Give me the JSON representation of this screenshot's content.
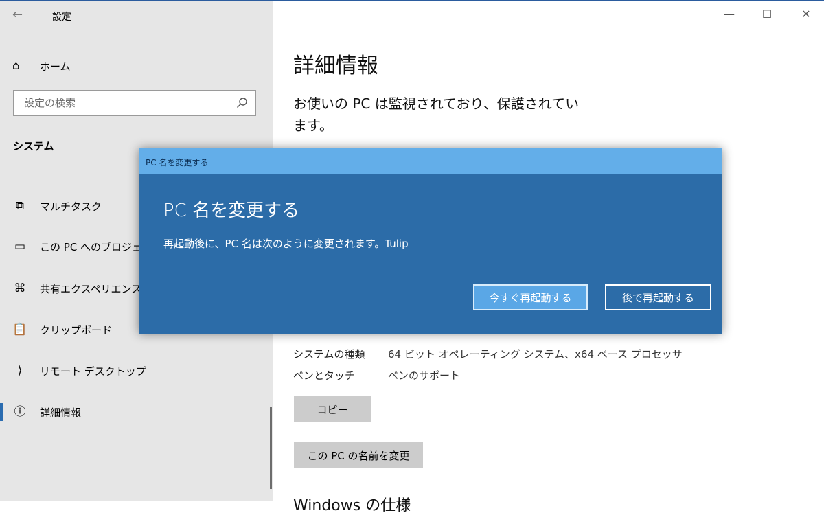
{
  "window": {
    "title": "設定",
    "controls": {
      "minimize": "—",
      "maximize": "☐",
      "close": "✕"
    }
  },
  "sidebar": {
    "home_label": "ホーム",
    "search_placeholder": "設定の検索",
    "section_title": "システム",
    "items": [
      {
        "label": "マルチタスク",
        "icon": "multitask-icon"
      },
      {
        "label": "この PC へのプロジェクション",
        "icon": "projection-icon"
      },
      {
        "label": "共有エクスペリエンス",
        "icon": "shared-experiences-icon"
      },
      {
        "label": "クリップボード",
        "icon": "clipboard-icon"
      },
      {
        "label": "リモート デスクトップ",
        "icon": "remote-desktop-icon"
      },
      {
        "label": "詳細情報",
        "icon": "info-icon",
        "active": true
      }
    ]
  },
  "main": {
    "title": "詳細情報",
    "subtitle": "お使いの PC は監視されており、保護されています。",
    "specs": [
      {
        "key": "システムの種類",
        "value": "64 ビット オペレーティング システム、x64 ベース プロセッサ"
      },
      {
        "key": "ペンとタッチ",
        "value": "ペンのサポート"
      }
    ],
    "copy_button": "コピー",
    "rename_button": "この PC の名前を変更",
    "bottom_heading": "Windows の仕様"
  },
  "dialog": {
    "titlebar": "PC 名を変更する",
    "heading": "PC 名を変更する",
    "message": "再起動後に、PC 名は次のように変更されます。Tulip",
    "restart_now": "今すぐ再起動する",
    "restart_later": "後で再起動する"
  }
}
